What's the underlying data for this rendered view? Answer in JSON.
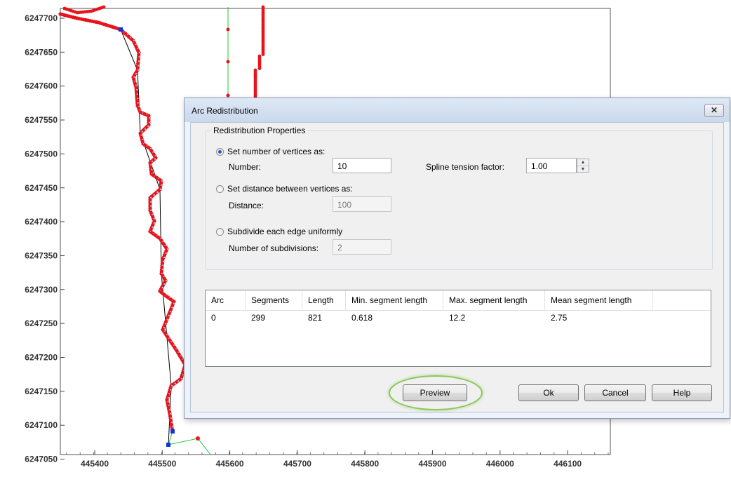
{
  "plot": {
    "y_ticks": [
      "6247700",
      "6247650",
      "6247600",
      "6247550",
      "6247500",
      "6247450",
      "6247400",
      "6247350",
      "6247300",
      "6247250",
      "6247200",
      "6247150",
      "6247100",
      "6247050"
    ],
    "x_ticks": [
      "445400",
      "445500",
      "445600",
      "445700",
      "445800",
      "445900",
      "446000",
      "446100"
    ],
    "colors": {
      "vertices": "#e8141c",
      "arc_line": "#000000",
      "preview_points": "#9ac0d8",
      "nodes": "#1034d8",
      "green_arc": "#22c832"
    }
  },
  "dialog": {
    "title": "Arc Redistribution",
    "close_glyph": "✕",
    "group_title": "Redistribution Properties",
    "opt_vertices_label": "Set number of vertices as:",
    "number_label": "Number:",
    "number_value": "10",
    "spline_label": "Spline tension factor:",
    "spline_value": "1.00",
    "opt_distance_label": "Set distance between vertices as:",
    "distance_label": "Distance:",
    "distance_value": "100",
    "opt_subdivide_label": "Subdivide each edge uniformly",
    "subdivisions_label": "Number of subdivisions:",
    "subdivisions_value": "2",
    "table": {
      "headers": [
        "Arc",
        "Segments",
        "Length",
        "Min. segment length",
        "Max. segment length",
        "Mean segment length"
      ],
      "rows": [
        [
          "0",
          "299",
          "821",
          "0.618",
          "12.2",
          "2.75"
        ]
      ]
    },
    "buttons": {
      "preview": "Preview",
      "ok": "Ok",
      "cancel": "Cancel",
      "help": "Help"
    }
  }
}
